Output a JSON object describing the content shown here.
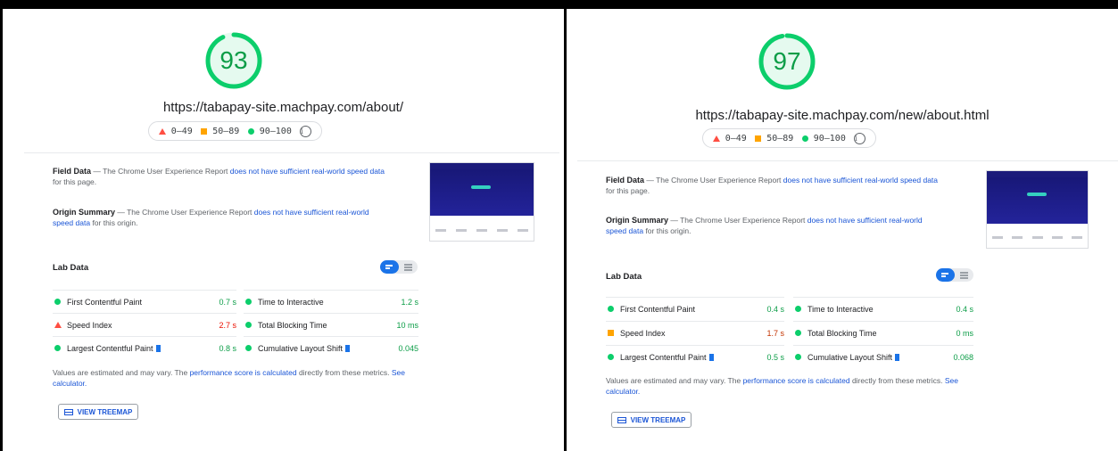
{
  "legend": {
    "poor": "0–49",
    "average": "50–89",
    "good": "90–100",
    "info_icon": "info-icon"
  },
  "colors": {
    "good": "#0cce6b",
    "average": "#ffa400",
    "poor": "#ff4e42",
    "link": "#1a55d6"
  },
  "panels": [
    {
      "score": "93",
      "score_fraction": 0.93,
      "url": "https://tabapay-site.machpay.com/about/",
      "field_title": "Field Data",
      "field_pre": " — The Chrome User Experience Report ",
      "field_link": "does not have sufficient real-world speed data",
      "field_post": " for this page.",
      "origin_title": "Origin Summary",
      "origin_pre": " — The Chrome User Experience Report ",
      "origin_link": "does not have sufficient real-world speed data",
      "origin_post": " for this origin.",
      "lab_title": "Lab Data",
      "metrics": {
        "fcp": {
          "label": "First Contentful Paint",
          "value": "0.7 s"
        },
        "si": {
          "label": "Speed Index",
          "value": "2.7 s"
        },
        "lcp": {
          "label": "Largest Contentful Paint",
          "value": "0.8 s"
        },
        "tti": {
          "label": "Time to Interactive",
          "value": "1.2 s"
        },
        "tbt": {
          "label": "Total Blocking Time",
          "value": "10 ms"
        },
        "cls": {
          "label": "Cumulative Layout Shift",
          "value": "0.045"
        }
      },
      "note_pre": "Values are estimated and may vary. The ",
      "note_link": "performance score is calculated",
      "note_post": " directly from these metrics. ",
      "note_link2": "See calculator.",
      "treemap_label": "VIEW TREEMAP"
    },
    {
      "score": "97",
      "score_fraction": 0.97,
      "url": "https://tabapay-site.machpay.com/new/about.html",
      "field_title": "Field Data",
      "field_pre": " — The Chrome User Experience Report ",
      "field_link": "does not have sufficient real-world speed data",
      "field_post": " for this page.",
      "origin_title": "Origin Summary",
      "origin_pre": " — The Chrome User Experience Report ",
      "origin_link": "does not have sufficient real-world speed data",
      "origin_post": " for this origin.",
      "lab_title": "Lab Data",
      "metrics": {
        "fcp": {
          "label": "First Contentful Paint",
          "value": "0.4 s"
        },
        "si": {
          "label": "Speed Index",
          "value": "1.7 s"
        },
        "lcp": {
          "label": "Largest Contentful Paint",
          "value": "0.5 s"
        },
        "tti": {
          "label": "Time to Interactive",
          "value": "0.4 s"
        },
        "tbt": {
          "label": "Total Blocking Time",
          "value": "0 ms"
        },
        "cls": {
          "label": "Cumulative Layout Shift",
          "value": "0.068"
        }
      },
      "note_pre": "Values are estimated and may vary. The ",
      "note_link": "performance score is calculated",
      "note_post": " directly from these metrics. ",
      "note_link2": "See calculator.",
      "treemap_label": "VIEW TREEMAP"
    }
  ]
}
